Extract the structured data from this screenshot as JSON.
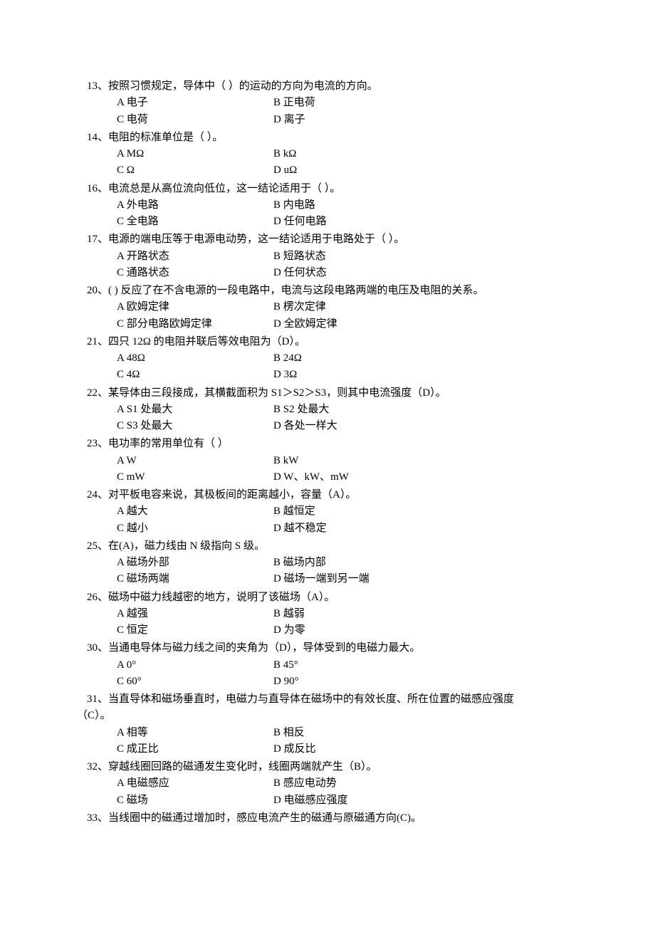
{
  "questions": [
    {
      "num": "13",
      "text": "、按照习惯规定，导体中（  ）的运动的方向为电流的方向。",
      "options": [
        [
          "A 电子",
          "B 正电荷"
        ],
        [
          "C 电荷",
          "D 离子"
        ]
      ]
    },
    {
      "num": "14",
      "text": "、电阻的标准单位是（  ）。",
      "options": [
        [
          "A   MΩ",
          "B   kΩ"
        ],
        [
          "C   Ω",
          "D   uΩ"
        ]
      ]
    },
    {
      "num": "16",
      "text": "、电流总是从高位流向低位，这一结论适用于（  ）。",
      "options": [
        [
          "A 外电路",
          "B 内电路"
        ],
        [
          "C 全电路",
          "D 任何电路"
        ]
      ]
    },
    {
      "num": "17",
      "text": "、电源的端电压等于电源电动势，这一结论适用于电路处于（  ）。",
      "options": [
        [
          "A 开路状态",
          "B 短路状态"
        ],
        [
          "C 通路状态",
          "D 任何状态"
        ]
      ]
    },
    {
      "num": "20",
      "text": "、(   )   反应了在不含电源的一段电路中，电流与这段电路两端的电压及电阻的关系。",
      "options": [
        [
          "A 欧姆定律",
          "B 楞次定律"
        ],
        [
          "C 部分电路欧姆定律",
          "D 全欧姆定律"
        ]
      ]
    },
    {
      "num": "21",
      "text": "、四只 12Ω 的电阻并联后等效电阻为（D）。",
      "options": [
        [
          "A   48Ω",
          "B   24Ω"
        ],
        [
          "C   4Ω",
          "D   3Ω"
        ]
      ]
    },
    {
      "num": "22",
      "text": "、某导体由三段接成，其横截面积为 S1＞S2＞S3，则其中电流强度（D）。",
      "options": [
        [
          "A   S1 处最大",
          "B   S2 处最大"
        ],
        [
          "C   S3 处最大",
          "D    各处一样大"
        ]
      ]
    },
    {
      "num": "23",
      "text": "、电功率的常用单位有（  ）",
      "options": [
        [
          "A     W",
          "B     kW"
        ],
        [
          "C     mW",
          "D     W、kW、mW"
        ]
      ]
    },
    {
      "num": "24",
      "text": "、对平板电容来说，其极板间的距离越小，容量（A）。",
      "options": [
        [
          "A 越大",
          "B 越恒定"
        ],
        [
          "C 越小",
          "D 越不稳定"
        ]
      ]
    },
    {
      "num": "25",
      "text": "、在(A)，磁力线由 N 级指向 S 级。",
      "options": [
        [
          "A 磁场外部",
          "B 磁场内部"
        ],
        [
          "C 磁场两端",
          "D 磁场一端到另一端"
        ]
      ]
    },
    {
      "num": "26",
      "text": "、磁场中磁力线越密的地方，说明了该磁场（A）。",
      "options": [
        [
          "A 越强",
          "B 越弱"
        ],
        [
          "C 恒定",
          "D 为零"
        ]
      ]
    },
    {
      "num": "30",
      "text": "、当通电导体与磁力线之间的夹角为（D），导体受到的电磁力最大。",
      "options": [
        [
          "A   0°",
          "B   45°"
        ],
        [
          "C   60°",
          "D   90°"
        ]
      ]
    },
    {
      "num": "31",
      "text": "、当直导体和磁场垂直时，电磁力与直导体在磁场中的有效长度、所在位置的磁感应强度",
      "cont": "（C）。",
      "options": [
        [
          "A 相等",
          "B 相反"
        ],
        [
          "C 成正比",
          "D 成反比"
        ]
      ]
    },
    {
      "num": "32",
      "text": "、穿越线圈回路的磁通发生变化时，线圈两端就产生（B）。",
      "options": [
        [
          "A 电磁感应",
          "B 感应电动势"
        ],
        [
          "C 磁场",
          "D 电磁感应强度"
        ]
      ]
    },
    {
      "num": "33",
      "text": "、当线圈中的磁通过增加时，感应电流产生的磁通与原磁通方向(C)。",
      "options": []
    }
  ]
}
